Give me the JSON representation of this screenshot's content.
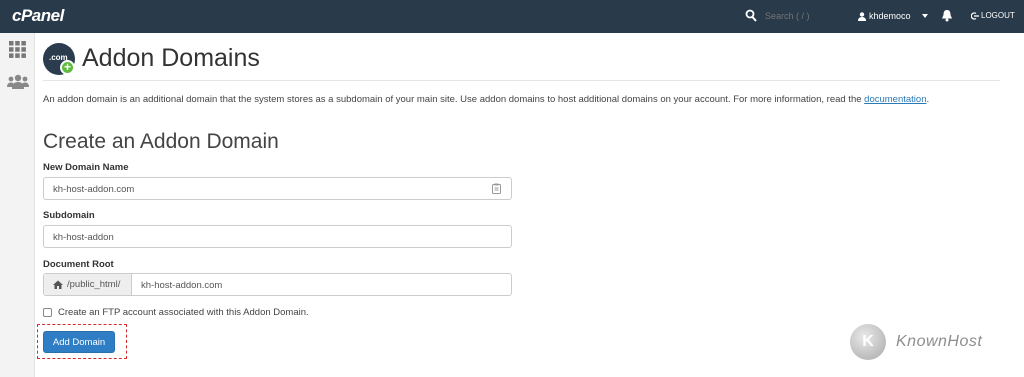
{
  "topbar": {
    "logo": "cPanel",
    "search_placeholder": "Search ( / )",
    "username": "khdemoco",
    "logout": "LOGOUT"
  },
  "page": {
    "title": "Addon Domains",
    "icon_text": ".com",
    "description": "An addon domain is an additional domain that the system stores as a subdomain of your main site. Use addon domains to host additional domains on your account. For more information, read the ",
    "description_link": "documentation",
    "description_end": "."
  },
  "form": {
    "section_title": "Create an Addon Domain",
    "new_domain_label": "New Domain Name",
    "new_domain_value": "kh-host-addon.com",
    "subdomain_label": "Subdomain",
    "subdomain_value": "kh-host-addon",
    "docroot_label": "Document Root",
    "docroot_prefix": "/public_html/",
    "docroot_value": "kh-host-addon.com",
    "ftp_checkbox_label": "Create an FTP account associated with this Addon Domain.",
    "ftp_checked": false,
    "submit_label": "Add Domain"
  },
  "watermark": {
    "brand": "KnownHost"
  },
  "colors": {
    "topbar": "#293a4a",
    "accent": "#2f7dc4",
    "highlight": "#d12b2b",
    "link": "#2a7ab8"
  }
}
